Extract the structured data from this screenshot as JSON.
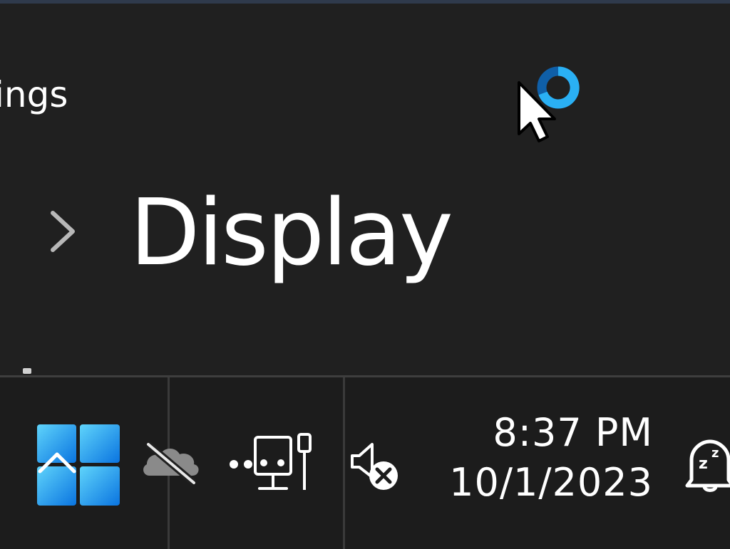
{
  "window": {
    "app_title_fragment": "ings",
    "page_title": "Display"
  },
  "taskbar": {
    "start_icon": "windows-logo-with-caret-icon",
    "tray_icons": [
      "onedrive-offline-icon",
      "network-ethernet-icon",
      "volume-muted-icon",
      "notification-do-not-disturb-icon"
    ],
    "clock": {
      "time": "8:37 PM",
      "date": "10/1/2023"
    }
  },
  "colors": {
    "background": "#202020",
    "taskbar": "#1c1c1c",
    "accent_blue": "#1a9dea",
    "text": "#ffffff"
  }
}
